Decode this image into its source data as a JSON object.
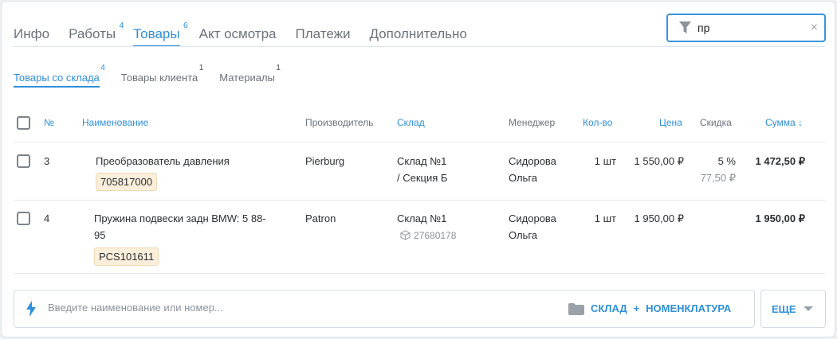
{
  "tabs": [
    {
      "label": "Инфо",
      "count": ""
    },
    {
      "label": "Работы",
      "count": "4"
    },
    {
      "label": "Товары",
      "count": "6",
      "active": true
    },
    {
      "label": "Акт осмотра",
      "count": ""
    },
    {
      "label": "Платежи",
      "count": ""
    },
    {
      "label": "Дополнительно",
      "count": ""
    }
  ],
  "search": {
    "value": "пр",
    "clear": "×"
  },
  "subtabs": [
    {
      "label": "Товары со склада",
      "count": "4",
      "active": true
    },
    {
      "label": "Товары клиента",
      "count": "1"
    },
    {
      "label": "Материалы",
      "count": "1"
    }
  ],
  "table": {
    "headers": {
      "num": "№",
      "name": "Наименование",
      "maker": "Производитель",
      "warehouse": "Склад",
      "manager": "Менеджер",
      "qty": "Кол-во",
      "price": "Цена",
      "discount": "Скидка",
      "sum": "Сумма ↓"
    },
    "rows": [
      {
        "num": "3",
        "name": "Преобразователь давления",
        "code": "705817000",
        "maker": "Pierburg",
        "warehouse_line1": "Склад №1",
        "warehouse_line2": "/ Секция Б",
        "manager_line1": "Сидорова",
        "manager_line2": "Ольга",
        "qty": "1 шт",
        "price": "1 550,00 ₽",
        "discount": "5 %",
        "discount_amount": "77,50 ₽",
        "sum": "1 472,50 ₽"
      },
      {
        "num": "4",
        "name_line1": "Пружина подвески задн BMW: 5 88-",
        "name_line2": "95",
        "code": "PCS101611",
        "maker": "Patron",
        "warehouse_line1": "Склад №1",
        "warehouse_sub": "27680178",
        "manager_line1": "Сидорова",
        "manager_line2": "Ольга",
        "qty": "1 шт",
        "price": "1 950,00 ₽",
        "sum": "1 950,00 ₽"
      }
    ]
  },
  "add_bar": {
    "placeholder": "Введите наименование или номер...",
    "link_warehouse": "СКЛАД",
    "plus": "+",
    "link_catalog": "НОМЕНКЛАТУРА"
  },
  "more_button": "ЕЩЕ",
  "colors": {
    "accent": "#2f8fd8",
    "tag_bg": "#fbeedb",
    "icon_gray": "#9aa1a8"
  }
}
